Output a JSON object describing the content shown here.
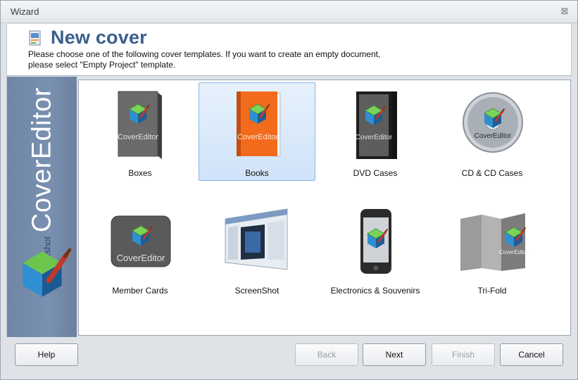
{
  "window": {
    "title": "Wizard",
    "close_glyph": "⊠"
  },
  "header": {
    "icon": "cover-document-icon",
    "title": "New cover",
    "description": "Please choose one of the following cover templates. If you want to create an empty document,\nplease select \"Empty Project\" template."
  },
  "sidebar": {
    "brand_small": "trueboxshot",
    "brand_big": "CoverEditor",
    "logo_icon": "cube-brush-logo-icon"
  },
  "templates": [
    {
      "label": "Boxes",
      "icon": "box-cover-icon",
      "selected": false
    },
    {
      "label": "Books",
      "icon": "book-cover-icon",
      "selected": true
    },
    {
      "label": "DVD Cases",
      "icon": "dvd-case-icon",
      "selected": false
    },
    {
      "label": "CD & CD Cases",
      "icon": "cd-disc-icon",
      "selected": false
    },
    {
      "label": "Member Cards",
      "icon": "member-card-icon",
      "selected": false
    },
    {
      "label": "ScreenShot",
      "icon": "screenshot-icon",
      "selected": false
    },
    {
      "label": "Electronics & Souvenirs",
      "icon": "phone-device-icon",
      "selected": false
    },
    {
      "label": "Tri-Fold",
      "icon": "trifold-brochure-icon",
      "selected": false
    }
  ],
  "product_mark": "CoverEditor",
  "buttons": {
    "help": "Help",
    "back": "Back",
    "next": "Next",
    "finish": "Finish",
    "cancel": "Cancel"
  },
  "colors": {
    "accent": "#3a5f8c",
    "selection": "#cfe3f9",
    "book_orange": "#f26a1b",
    "sidebar": "#7a90b0"
  }
}
